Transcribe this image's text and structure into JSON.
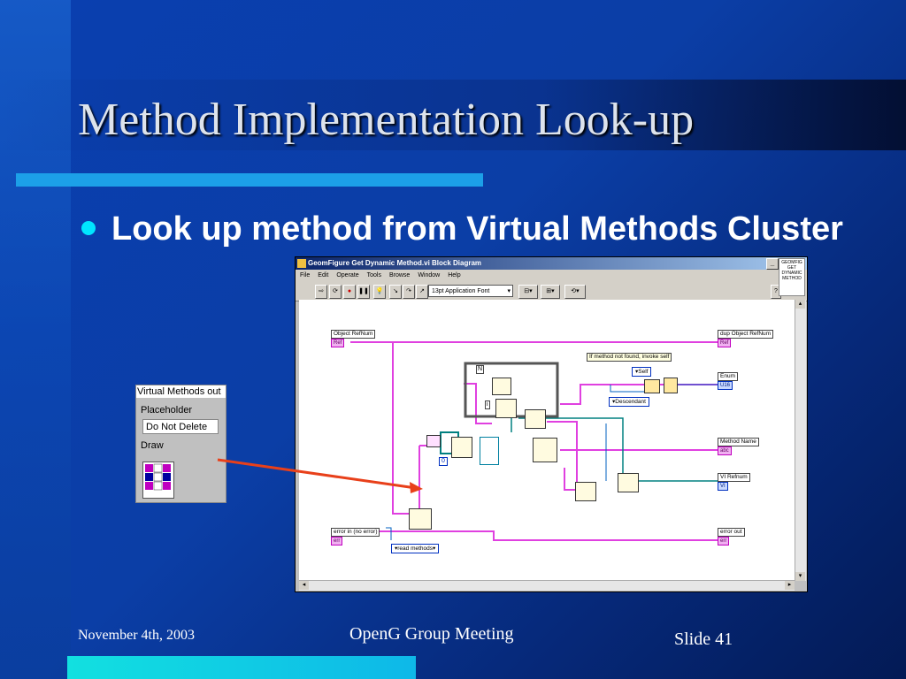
{
  "slide": {
    "title": "Method Implementation Look-up",
    "bullet": "Look up method from Virtual Methods Cluster",
    "footer_date": "November 4th, 2003",
    "footer_meeting": "OpenG Group Meeting",
    "footer_slide": "Slide 41"
  },
  "window": {
    "title": "GeomFigure Get Dynamic Method.vi Block Diagram",
    "menu": [
      "File",
      "Edit",
      "Operate",
      "Tools",
      "Browse",
      "Window",
      "Help"
    ],
    "font_select": "13pt Application Font",
    "help_text": "GEOMFIG GET DYNAMIC METHOD"
  },
  "diagram": {
    "object_refnum": "Object RefNum",
    "dup_object_refnum": "dup Object RefNum",
    "comment": "If method not found, invoke self",
    "self_enum": "Self",
    "descendant_enum": "Descendant",
    "enum_label": "Enum",
    "method_name": "Method Name",
    "vi_refnum": "VI Refnum",
    "error_in": "error in (no error)",
    "error_out": "error out",
    "read_methods": "read methods",
    "n_label": "N",
    "i_label": "i",
    "zero_const": "0"
  },
  "cluster": {
    "title": "Virtual Methods out",
    "placeholder_label": "Placeholder",
    "placeholder_value": "Do Not Delete",
    "draw_label": "Draw"
  },
  "colors": {
    "background": "#0b3ea6",
    "accent_bar": "#1ca0e8",
    "bullet": "#00e6ff",
    "arrow": "#e8401a",
    "wire_pink": "#e040e0",
    "wire_teal": "#008080"
  }
}
